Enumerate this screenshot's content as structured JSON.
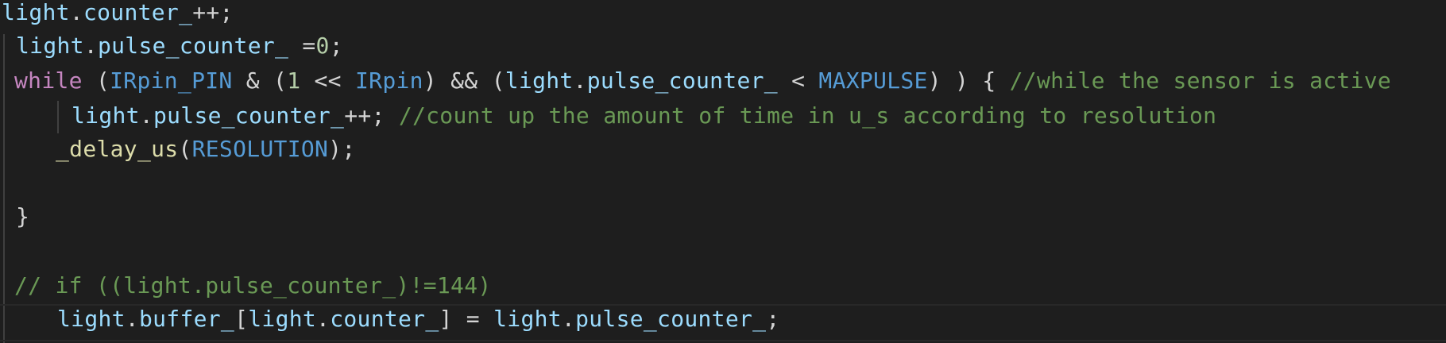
{
  "editor": {
    "lines": [
      {
        "tokens": [
          {
            "t": "light",
            "k": "var"
          },
          {
            "t": ".",
            "k": "op"
          },
          {
            "t": "counter_",
            "k": "var"
          },
          {
            "t": "++;",
            "k": "op"
          }
        ]
      },
      {
        "tokens": [
          {
            "t": "light",
            "k": "var"
          },
          {
            "t": ".",
            "k": "op"
          },
          {
            "t": "pulse_counter_",
            "k": "var"
          },
          {
            "t": " =",
            "k": "op"
          },
          {
            "t": "0",
            "k": "num"
          },
          {
            "t": ";",
            "k": "op"
          }
        ]
      },
      {
        "tokens": [
          {
            "t": "while",
            "k": "kw"
          },
          {
            "t": " (",
            "k": "op"
          },
          {
            "t": "IRpin_PIN",
            "k": "macro"
          },
          {
            "t": " & (",
            "k": "op"
          },
          {
            "t": "1",
            "k": "num"
          },
          {
            "t": " << ",
            "k": "op"
          },
          {
            "t": "IRpin",
            "k": "macro"
          },
          {
            "t": ") && (",
            "k": "op"
          },
          {
            "t": "light",
            "k": "var"
          },
          {
            "t": ".",
            "k": "op"
          },
          {
            "t": "pulse_counter_",
            "k": "var"
          },
          {
            "t": " < ",
            "k": "op"
          },
          {
            "t": "MAXPULSE",
            "k": "macro"
          },
          {
            "t": ") ) { ",
            "k": "op"
          },
          {
            "t": "//while the sensor is active",
            "k": "cmt"
          }
        ]
      },
      {
        "tokens": [
          {
            "t": "light",
            "k": "var"
          },
          {
            "t": ".",
            "k": "op"
          },
          {
            "t": "pulse_counter_",
            "k": "var"
          },
          {
            "t": "++; ",
            "k": "op"
          },
          {
            "t": "//count up the amount of time in u_s according to resolution",
            "k": "cmt"
          }
        ]
      },
      {
        "tokens": [
          {
            "t": "_delay_us",
            "k": "fn"
          },
          {
            "t": "(",
            "k": "op"
          },
          {
            "t": "RESOLUTION",
            "k": "macro"
          },
          {
            "t": ");",
            "k": "op"
          }
        ]
      },
      {
        "tokens": []
      },
      {
        "tokens": [
          {
            "t": "}",
            "k": "op"
          }
        ]
      },
      {
        "tokens": []
      },
      {
        "tokens": [
          {
            "t": "// if ((light.pulse_counter_)!=144)",
            "k": "cmt"
          }
        ]
      },
      {
        "tokens": [
          {
            "t": "light",
            "k": "var"
          },
          {
            "t": ".",
            "k": "op"
          },
          {
            "t": "buffer_",
            "k": "var"
          },
          {
            "t": "[",
            "k": "op"
          },
          {
            "t": "light",
            "k": "var"
          },
          {
            "t": ".",
            "k": "op"
          },
          {
            "t": "counter_",
            "k": "var"
          },
          {
            "t": "] = ",
            "k": "op"
          },
          {
            "t": "light",
            "k": "var"
          },
          {
            "t": ".",
            "k": "op"
          },
          {
            "t": "pulse_counter_",
            "k": "var"
          },
          {
            "t": ";",
            "k": "op"
          }
        ]
      }
    ]
  },
  "theme": {
    "background": "#1e1e1e",
    "variable": "#9cdcfe",
    "function": "#dcdcaa",
    "keyword": "#c586c0",
    "macro": "#569cd6",
    "number": "#b5cea8",
    "operator": "#d4d4d4",
    "comment": "#6a9955",
    "indent_guide": "#404040"
  }
}
